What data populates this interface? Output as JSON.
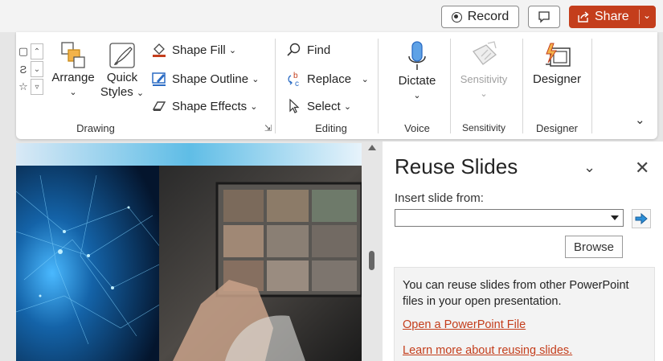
{
  "titlebar": {
    "record_label": "Record",
    "share_label": "Share",
    "colors": {
      "share": "#c43e1c"
    },
    "icons": {
      "record": "record-icon",
      "comments": "comment-icon",
      "share": "share-icon",
      "share_chevron": "chevron-down-icon"
    }
  },
  "ribbon": {
    "drawing": {
      "arrange_label": "Arrange",
      "quick_styles_label": [
        "Quick",
        "Styles"
      ],
      "shape_fill_label": "Shape Fill",
      "shape_outline_label": "Shape Outline",
      "shape_effects_label": "Shape Effects",
      "group_label": "Drawing"
    },
    "editing": {
      "find_label": "Find",
      "replace_label": "Replace",
      "select_label": "Select",
      "group_label": "Editing"
    },
    "voice": {
      "dictate_label": "Dictate",
      "group_label": "Voice"
    },
    "sensitivity": {
      "sensitivity_label": "Sensitivity",
      "group_label": "Sensitivity"
    },
    "designer": {
      "designer_label": "Designer",
      "group_label": "Designer"
    }
  },
  "pane": {
    "title": "Reuse Slides",
    "insert_label": "Insert slide from:",
    "source_value": "",
    "browse_label": "Browse",
    "info_text": "You can reuse slides from other PowerPoint files in your open presentation.",
    "open_link": "Open a PowerPoint File",
    "learn_link": "Learn more about reusing slides.",
    "colors": {
      "link": "#c43e1c"
    }
  }
}
